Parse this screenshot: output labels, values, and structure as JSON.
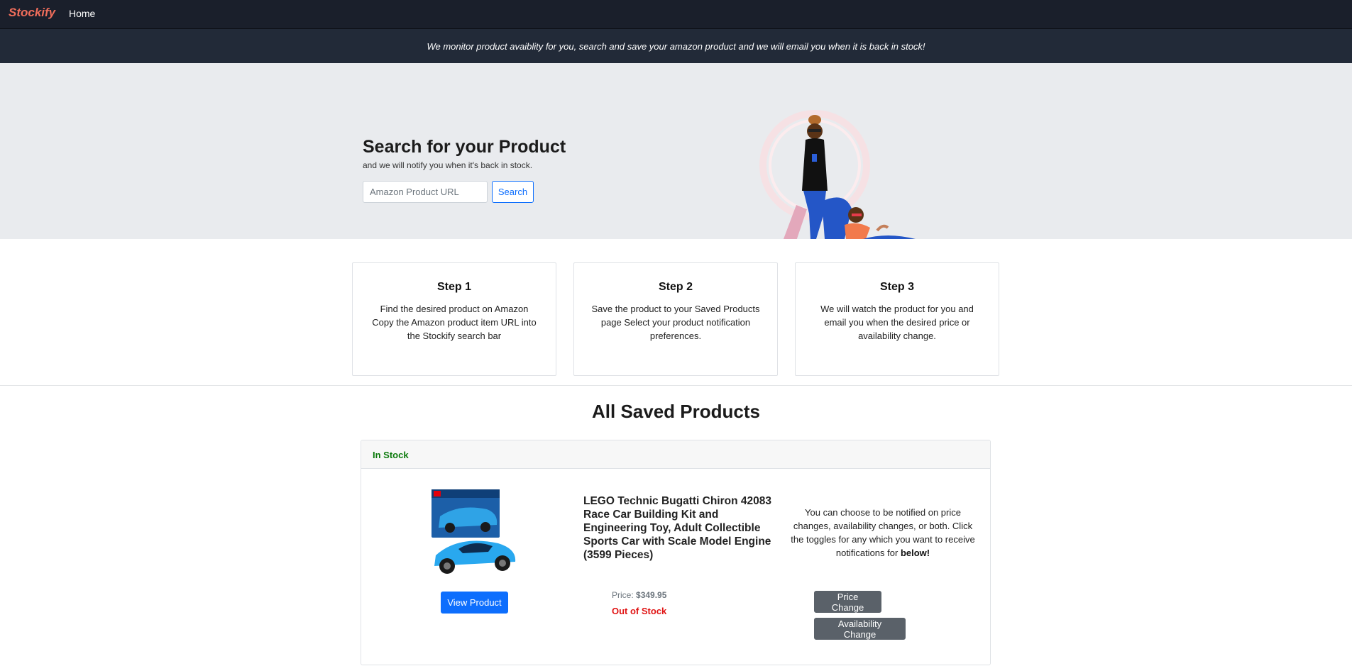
{
  "navbar": {
    "brand": "Stockify",
    "home_label": "Home"
  },
  "announcement": "We monitor product avaiblity for you, search and save your amazon product and we will email you when it is back in stock!",
  "hero": {
    "title": "Search for your Product",
    "subtitle": "and we will notify you when it's back in stock.",
    "search_placeholder": "Amazon Product URL",
    "search_value": "",
    "search_button": "Search"
  },
  "steps": [
    {
      "title": "Step 1",
      "text": "Find the desired product on Amazon Copy the Amazon product item URL into the Stockify search bar"
    },
    {
      "title": "Step 2",
      "text": "Save the product to your Saved Products page Select your product notification preferences."
    },
    {
      "title": "Step 3",
      "text": "We will watch the product for you and email you when the desired price or availability change."
    }
  ],
  "saved": {
    "title": "All Saved Products",
    "products": [
      {
        "stock_status": "In Stock",
        "name": "LEGO Technic Bugatti Chiron 42083 Race Car Building Kit and Engineering Toy, Adult Collectible Sports Car with Scale Model Engine (3599 Pieces)",
        "view_button": "View Product",
        "price_label": "Price:",
        "price_value": "$349.95",
        "availability": "Out of Stock",
        "notify_text": "You can choose to be notified on price changes, availability changes, or both. Click the toggles for any which you want to receive notifications for",
        "notify_emphasis": "below!",
        "toggle_price": "Price Change",
        "toggle_availability": "Availability Change"
      }
    ]
  },
  "colors": {
    "brand": "#ef6d5b",
    "navbar": "#1a1f2b",
    "announce": "#222a38",
    "primary": "#0d6efd",
    "in_stock": "#0c7a0c",
    "out_of_stock": "#e01414",
    "toggle": "#5a6169"
  }
}
